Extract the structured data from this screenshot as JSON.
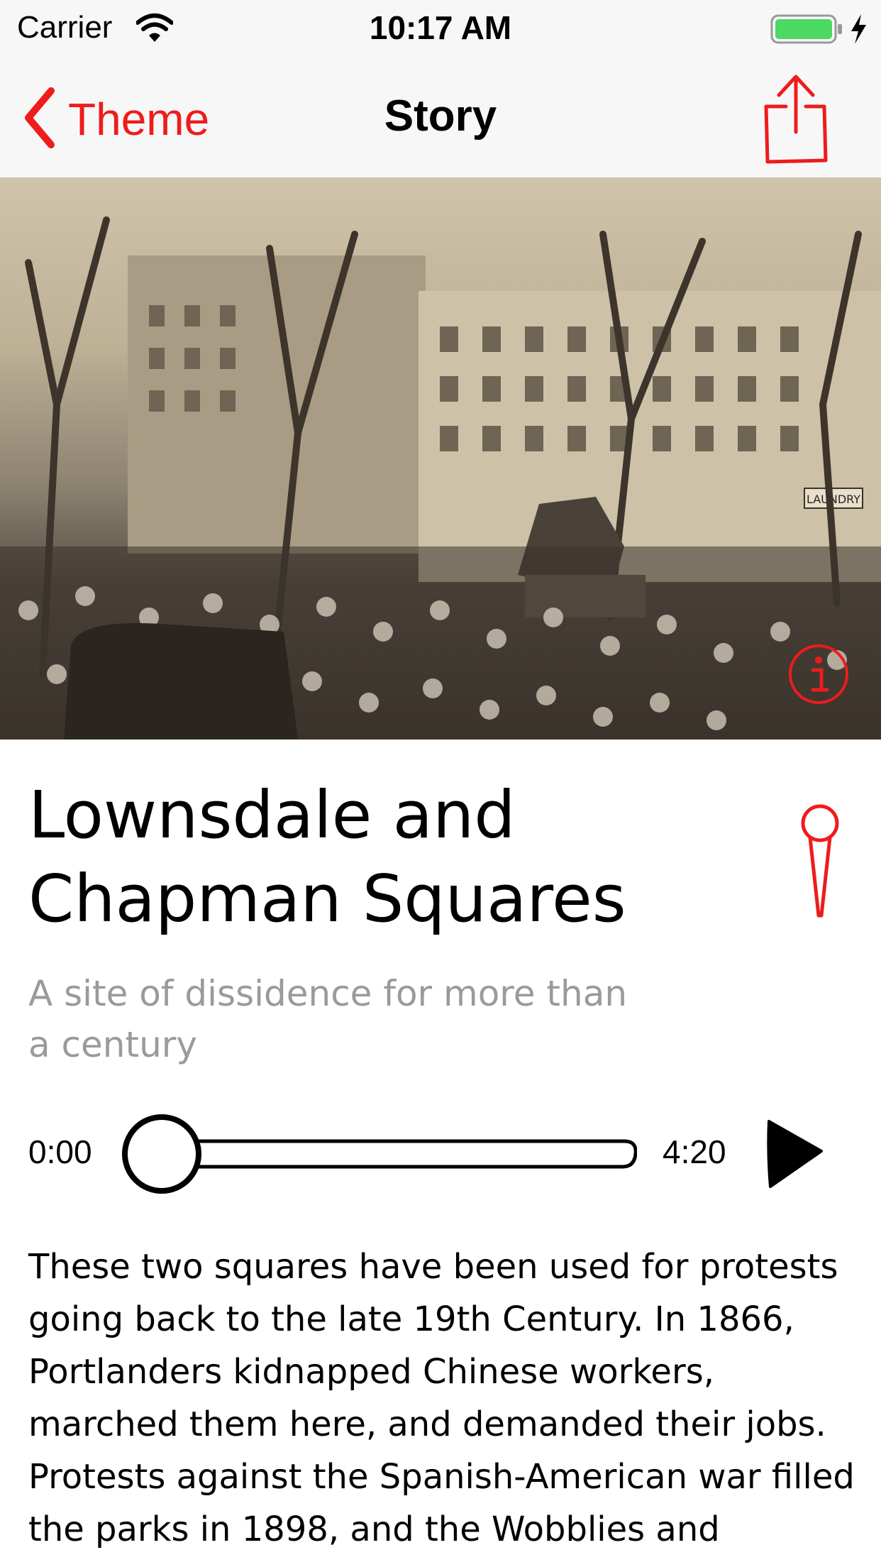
{
  "status_bar": {
    "carrier": "Carrier",
    "time": "10:17 AM",
    "wifi_icon": "wifi-icon",
    "battery_icon": "battery-charging-icon",
    "battery_color": "#4cd964"
  },
  "nav": {
    "back_label": "Theme",
    "title": "Story",
    "back_icon": "chevron-left-icon",
    "share_icon": "share-icon"
  },
  "hero": {
    "shop_sign": "LAUNDRY",
    "info_icon": "info-icon"
  },
  "story": {
    "title": "Lownsdale and Chapman Squares",
    "subtitle": "A site of dissidence for more than a century",
    "pin_icon": "map-pin-icon",
    "body": "These two squares have been used for protests going back to the late 19th Century. In 1866, Portlanders kidnapped Chinese workers, marched them here, and demanded their jobs. Protests against the Spanish-American war filled the parks in 1898, and the Wobblies and"
  },
  "player": {
    "current_time": "0:00",
    "duration": "4:20",
    "progress": 0,
    "play_icon": "play-icon"
  },
  "colors": {
    "accent": "#ee1c1c",
    "subtitle_gray": "#9a9a9a",
    "bar_background": "#f7f7f7"
  }
}
